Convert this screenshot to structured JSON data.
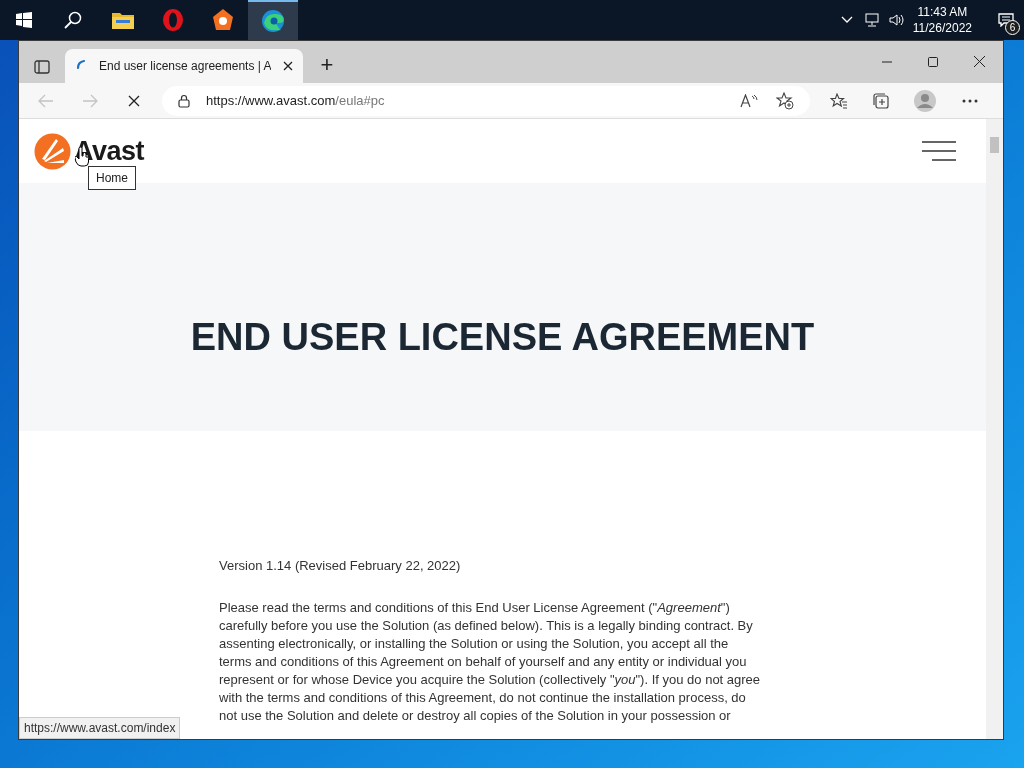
{
  "taskbar": {
    "apps": [
      {
        "kind": "search",
        "selected": false
      },
      {
        "kind": "folder",
        "selected": false
      },
      {
        "kind": "opera",
        "selected": false
      },
      {
        "kind": "avast",
        "selected": false
      },
      {
        "kind": "edge",
        "selected": true
      }
    ],
    "time": "11:43 AM",
    "date": "11/26/2022",
    "notification_count": "6"
  },
  "browser": {
    "tab": {
      "title": "End user license agreements | A",
      "loading": true
    },
    "new_tab": "+",
    "address": {
      "url_host": "https://www.avast.com",
      "url_path": "/eula#pc"
    },
    "status_url": "https://www.avast.com/index"
  },
  "page": {
    "logo": "Avast",
    "tooltip": "Home",
    "title": "END USER LICENSE AGREEMENT",
    "version": "Version 1.14 (Revised February 22, 2022)",
    "paragraph_lines": [
      "Please read the terms and conditions of this End User License Agreement (\"*Agreement*\")",
      "carefully before you use the Solution (as defined below). This is a legally binding contract. By",
      "assenting electronically, or installing the Solution or using the Solution, you accept all the",
      "terms and conditions of this Agreement on behalf of yourself and any entity or individual you",
      "represent or for whose Device you acquire the Solution (collectively \"*you*\"). If you do not agree",
      "with the terms and conditions of this Agreement, do not continue the installation process, do",
      "not use the Solution and delete or destroy all copies of the Solution in your possession or"
    ]
  }
}
